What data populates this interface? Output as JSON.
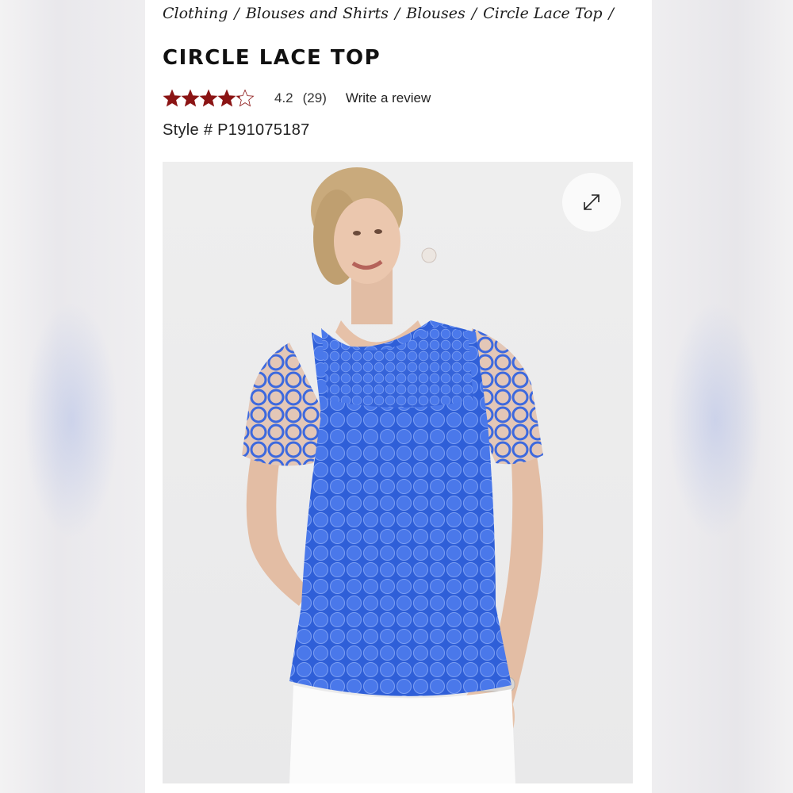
{
  "breadcrumb": [
    {
      "label": "Clothing"
    },
    {
      "label": "Blouses and Shirts"
    },
    {
      "label": "Blouses"
    },
    {
      "label": "Circle Lace Top"
    }
  ],
  "breadcrumb_separator": "/",
  "product": {
    "title": "CIRCLE LACE TOP",
    "rating": {
      "value_label": "4.2",
      "count_label": "(29)",
      "value": 4.2,
      "max": 5,
      "star_color": "#8b1414"
    },
    "write_review_label": "Write a review",
    "style_number": "Style # P191075187"
  },
  "gallery": {
    "expand_icon": "expand-arrows-icon",
    "garment_color": "#3f6fe0"
  }
}
